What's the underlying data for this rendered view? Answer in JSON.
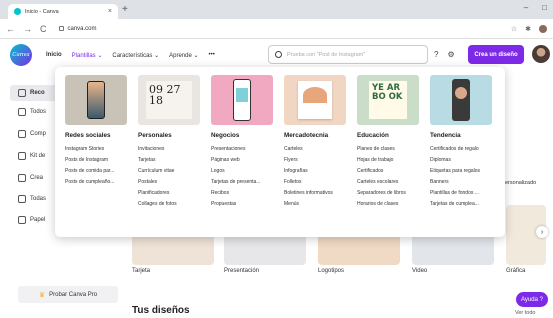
{
  "browser": {
    "tab_title": "Inicio - Canva",
    "url": "canva.com"
  },
  "header": {
    "logo_text": "Canva",
    "nav": [
      "Inicio",
      "Plantillas",
      "Características",
      "Aprende"
    ],
    "more": "•••",
    "search_placeholder": "Prueba con \"Post de Instagram\"",
    "create_button": "Crea un diseño"
  },
  "sidebar": {
    "items": [
      "Reco",
      "Todos",
      "Comp",
      "Kit de",
      "Crea",
      "Todas",
      "Papel"
    ],
    "pro_button": "Probar Canva Pro"
  },
  "background": {
    "labels": [
      "Tarjeta",
      "Presentación",
      "Logotipos",
      "Video",
      "Gráfica"
    ],
    "section_title": "Tus diseños",
    "help_button": "Ayuda ?",
    "see_all": "Ver todo",
    "personalizado": "ersonalizado"
  },
  "mega_menu": {
    "columns": [
      {
        "title": "Redes sociales",
        "items": [
          "Instagram Stories",
          "Posts de Instagram",
          "Posts de comida par...",
          "Posts de cumpleaño..."
        ]
      },
      {
        "title": "Personales",
        "thumb_text": "09 27 18",
        "items": [
          "Invitaciones",
          "Tarjetas",
          "Currículum vitae",
          "Postales",
          "Planificadores",
          "Collages de fotos"
        ]
      },
      {
        "title": "Negocios",
        "items": [
          "Presentaciones",
          "Páginas web",
          "Logos",
          "Tarjetas de presenta...",
          "Recibos",
          "Propuestas"
        ]
      },
      {
        "title": "Mercadotecnia",
        "items": [
          "Carteles",
          "Flyers",
          "Infografías",
          "Folletos",
          "Boletines informativos",
          "Menús"
        ]
      },
      {
        "title": "Educación",
        "thumb_text": "YE AR BO OK",
        "items": [
          "Planes de clases",
          "Hojas de trabajo",
          "Certificados",
          "Carteles escolares",
          "Separadores de libros",
          "Horarios de clases"
        ]
      },
      {
        "title": "Tendencia",
        "items": [
          "Certificados de regalo",
          "Diplomas",
          "Etiquetas para regalos",
          "Banners",
          "Plantillas de fondos ...",
          "Tarjetas de cumplea..."
        ]
      }
    ]
  }
}
